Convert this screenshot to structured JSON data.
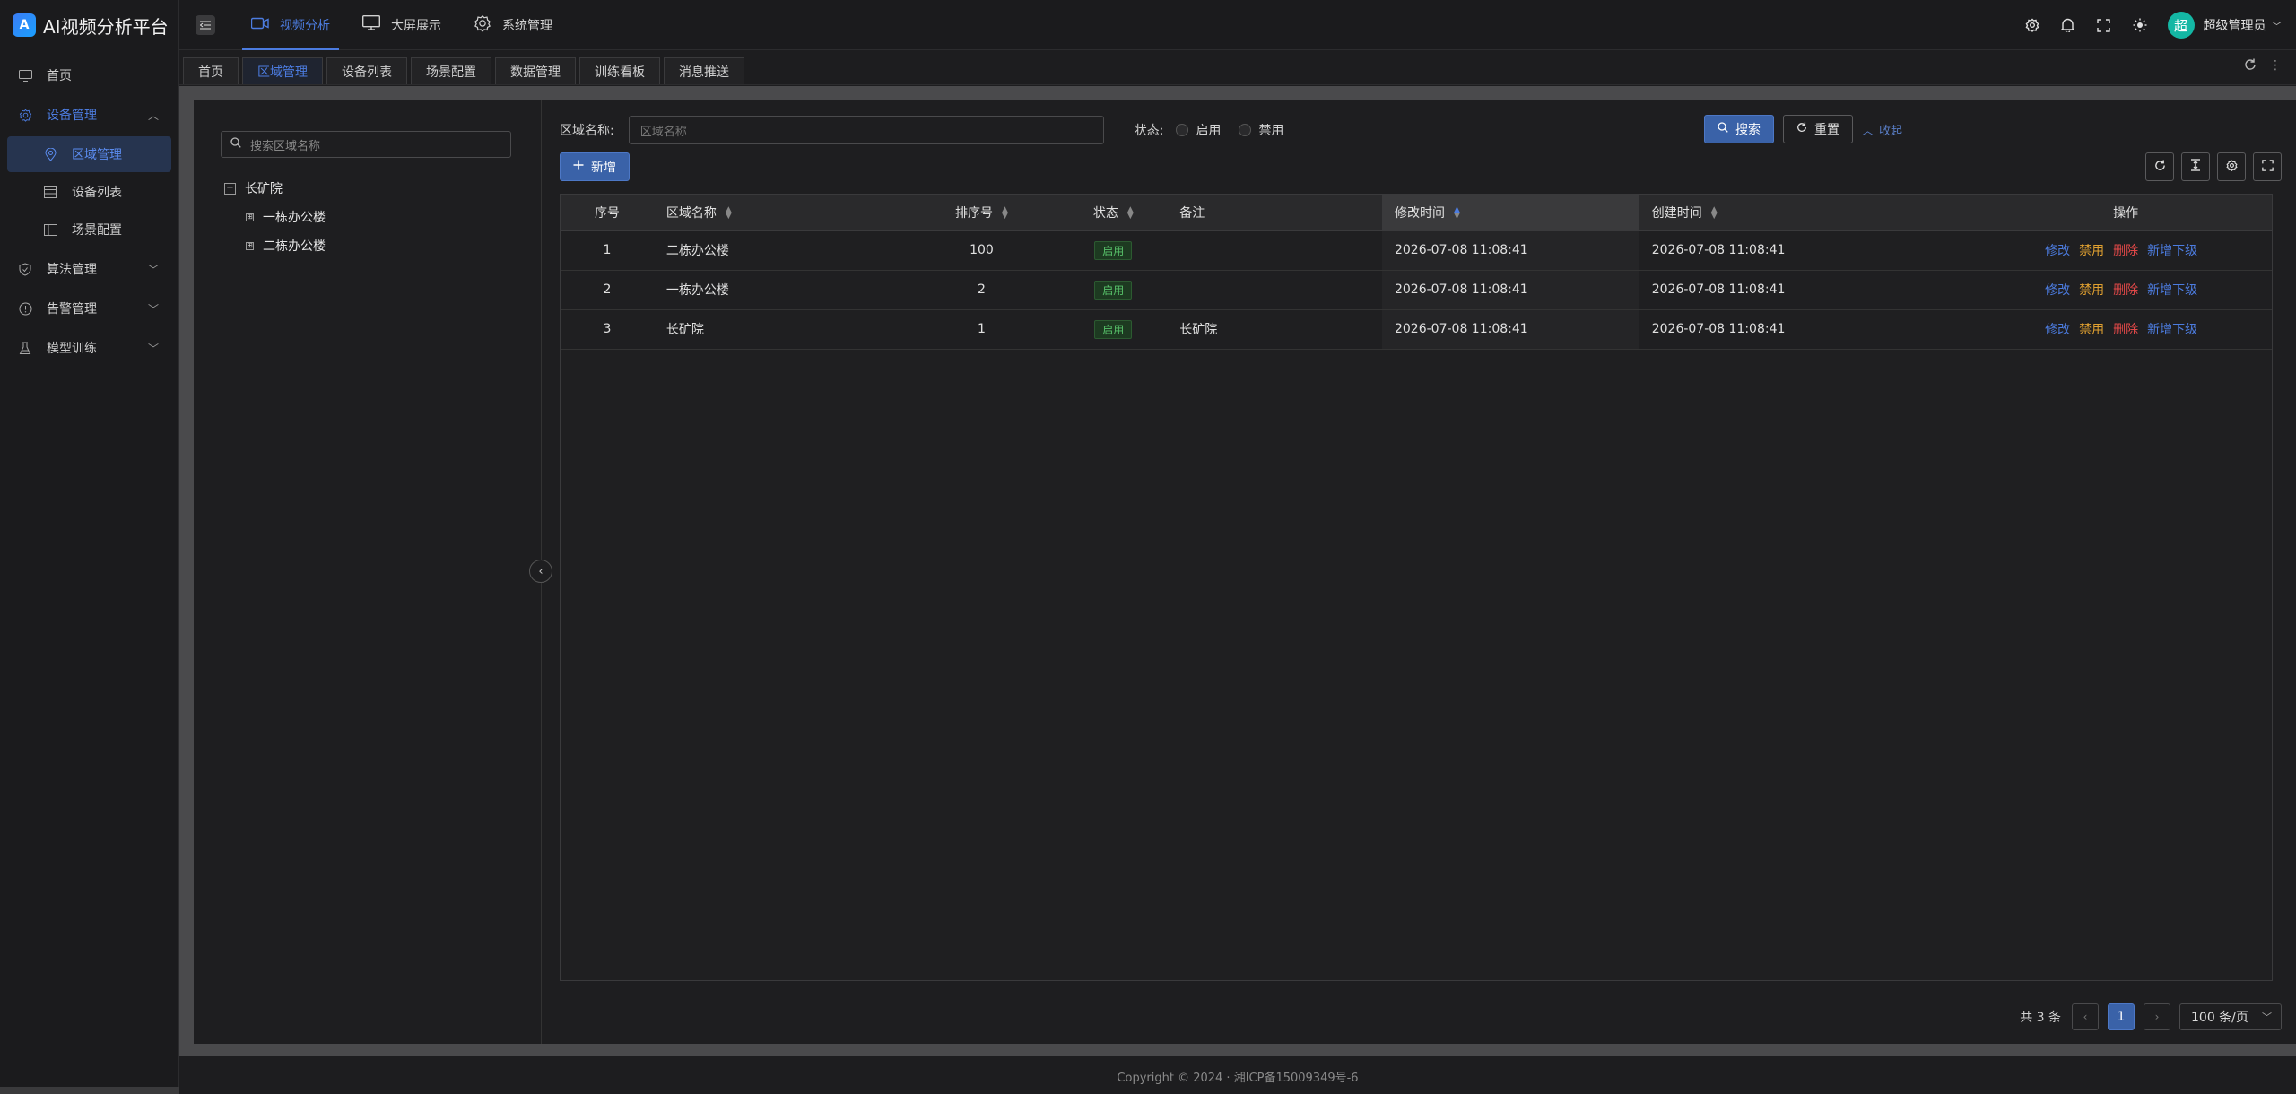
{
  "app": {
    "title": "AI视频分析平台",
    "logo_icon": "logo-icon"
  },
  "sidebar": {
    "items": [
      {
        "label": "首页",
        "icon": "monitor-icon"
      },
      {
        "label": "设备管理",
        "icon": "gear-icon",
        "expanded": true,
        "children": [
          {
            "label": "区域管理",
            "icon": "location-icon",
            "active": true
          },
          {
            "label": "设备列表",
            "icon": "list-icon"
          },
          {
            "label": "场景配置",
            "icon": "layout-icon"
          }
        ]
      },
      {
        "label": "算法管理",
        "icon": "shield-icon"
      },
      {
        "label": "告警管理",
        "icon": "alert-icon"
      },
      {
        "label": "模型训练",
        "icon": "flask-icon"
      }
    ]
  },
  "topnav": {
    "items": [
      {
        "label": "视频分析",
        "icon": "video-icon",
        "active": true
      },
      {
        "label": "大屏展示",
        "icon": "monitor-icon"
      },
      {
        "label": "系统管理",
        "icon": "gear-icon"
      }
    ]
  },
  "header": {
    "avatar_text": "超",
    "user_name": "超级管理员"
  },
  "tabs": [
    "首页",
    "区域管理",
    "设备列表",
    "场景配置",
    "数据管理",
    "训练看板",
    "消息推送"
  ],
  "active_tab": "区域管理",
  "tree": {
    "search_placeholder": "搜索区域名称",
    "root": "长矿院",
    "children": [
      "一栋办公楼",
      "二栋办公楼"
    ]
  },
  "filter": {
    "name_label": "区域名称:",
    "name_placeholder": "区域名称",
    "status_label": "状态:",
    "status_options": [
      "启用",
      "禁用"
    ],
    "search_label": "搜索",
    "reset_label": "重置",
    "collapse_label": "收起",
    "add_label": "新增"
  },
  "table": {
    "columns": [
      "序号",
      "区域名称",
      "排序号",
      "状态",
      "备注",
      "修改时间",
      "创建时间",
      "操作"
    ],
    "rows": [
      {
        "index": "1",
        "name": "二栋办公楼",
        "sort": "100",
        "status": "启用",
        "remark": "",
        "modified": "2026-07-08 11:08:41",
        "created": "2026-07-08 11:08:41"
      },
      {
        "index": "2",
        "name": "一栋办公楼",
        "sort": "2",
        "status": "启用",
        "remark": "",
        "modified": "2026-07-08 11:08:41",
        "created": "2026-07-08 11:08:41"
      },
      {
        "index": "3",
        "name": "长矿院",
        "sort": "1",
        "status": "启用",
        "remark": "长矿院",
        "modified": "2026-07-08 11:08:41",
        "created": "2026-07-08 11:08:41"
      }
    ],
    "actions": [
      "修改",
      "禁用",
      "删除",
      "新增下级"
    ]
  },
  "pagination": {
    "total_text": "共 3 条",
    "current_page": "1",
    "page_size": "100 条/页"
  },
  "footer": "Copyright © 2024 · 湘ICP备15009349号-6",
  "colors": {
    "accent": "#4c7ce0",
    "success": "#58c26a",
    "warning": "#e0a030",
    "danger": "#e04848"
  }
}
